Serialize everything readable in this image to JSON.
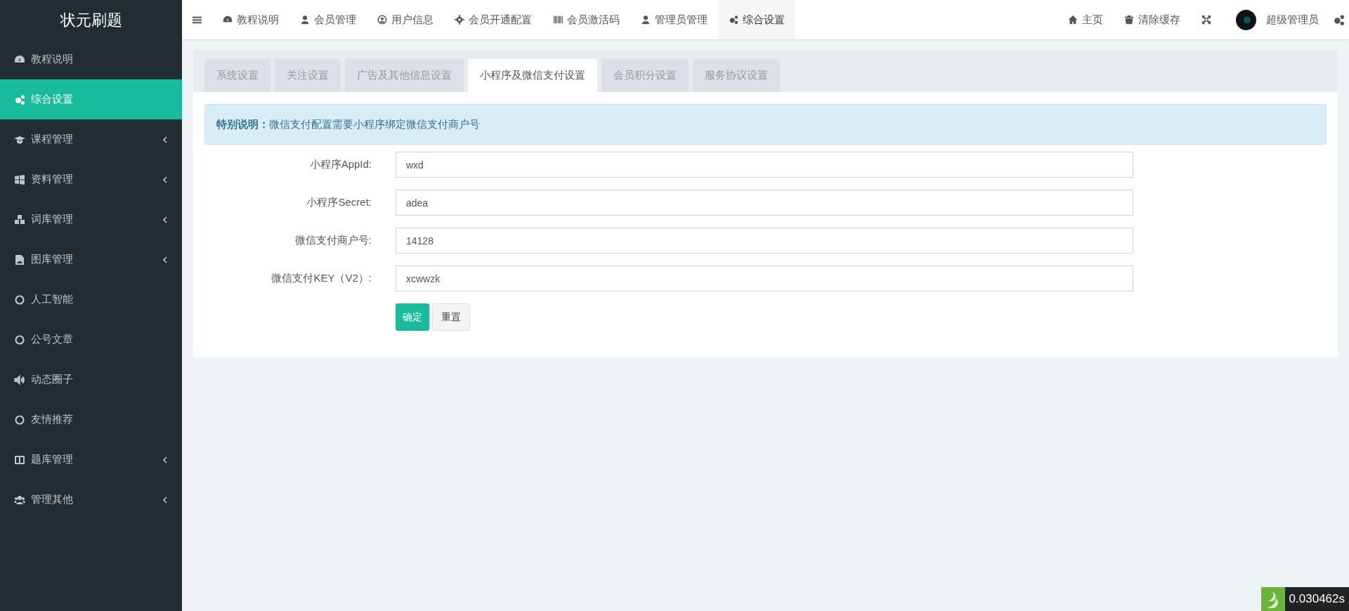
{
  "sidebar": {
    "title": "状元刷题",
    "items": [
      {
        "label": "教程说明",
        "selected": false,
        "expandable": false
      },
      {
        "label": "综合设置",
        "selected": true,
        "expandable": false
      },
      {
        "label": "课程管理",
        "selected": false,
        "expandable": true
      },
      {
        "label": "资料管理",
        "selected": false,
        "expandable": true
      },
      {
        "label": "词库管理",
        "selected": false,
        "expandable": true
      },
      {
        "label": "图库管理",
        "selected": false,
        "expandable": true
      },
      {
        "label": "人工智能",
        "selected": false,
        "expandable": false
      },
      {
        "label": "公号文章",
        "selected": false,
        "expandable": false
      },
      {
        "label": "动态圈子",
        "selected": false,
        "expandable": false
      },
      {
        "label": "友情推荐",
        "selected": false,
        "expandable": false
      },
      {
        "label": "题库管理",
        "selected": false,
        "expandable": true
      },
      {
        "label": "管理其他",
        "selected": false,
        "expandable": true
      }
    ]
  },
  "top_nav": {
    "items": [
      {
        "label": "教程说明",
        "selected": false
      },
      {
        "label": "会员管理",
        "selected": false
      },
      {
        "label": "用户信息",
        "selected": false
      },
      {
        "label": "会员开通配置",
        "selected": false
      },
      {
        "label": "会员激活码",
        "selected": false
      },
      {
        "label": "管理员管理",
        "selected": false
      },
      {
        "label": "综合设置",
        "selected": true
      }
    ],
    "right": [
      {
        "label": "主页"
      },
      {
        "label": "清除缓存"
      }
    ],
    "user": "超级管理员"
  },
  "tabs": [
    {
      "label": "系统设置",
      "selected": false
    },
    {
      "label": "关注设置",
      "selected": false
    },
    {
      "label": "广告及其他信息设置",
      "selected": false
    },
    {
      "label": "小程序及微信支付设置",
      "selected": true
    },
    {
      "label": "会员积分设置",
      "selected": false
    },
    {
      "label": "服务协议设置",
      "selected": false
    }
  ],
  "alert": "**特别说明：**微信支付配置需要小程序绑定微信支付商户号",
  "fields": [
    {
      "label": "小程序AppId:",
      "value": "wxd"
    },
    {
      "label": "小程序Secret:",
      "value": "adea"
    },
    {
      "label": "微信支付商户号:",
      "value": "14128"
    },
    {
      "label": "微信支付KEY（V2）:",
      "value": "xcwwzk"
    }
  ],
  "buttons": [
    {
      "label": "确定",
      "kind": "primary"
    },
    {
      "label": "重置",
      "kind": "default"
    }
  ],
  "timer": "0.030462s"
}
